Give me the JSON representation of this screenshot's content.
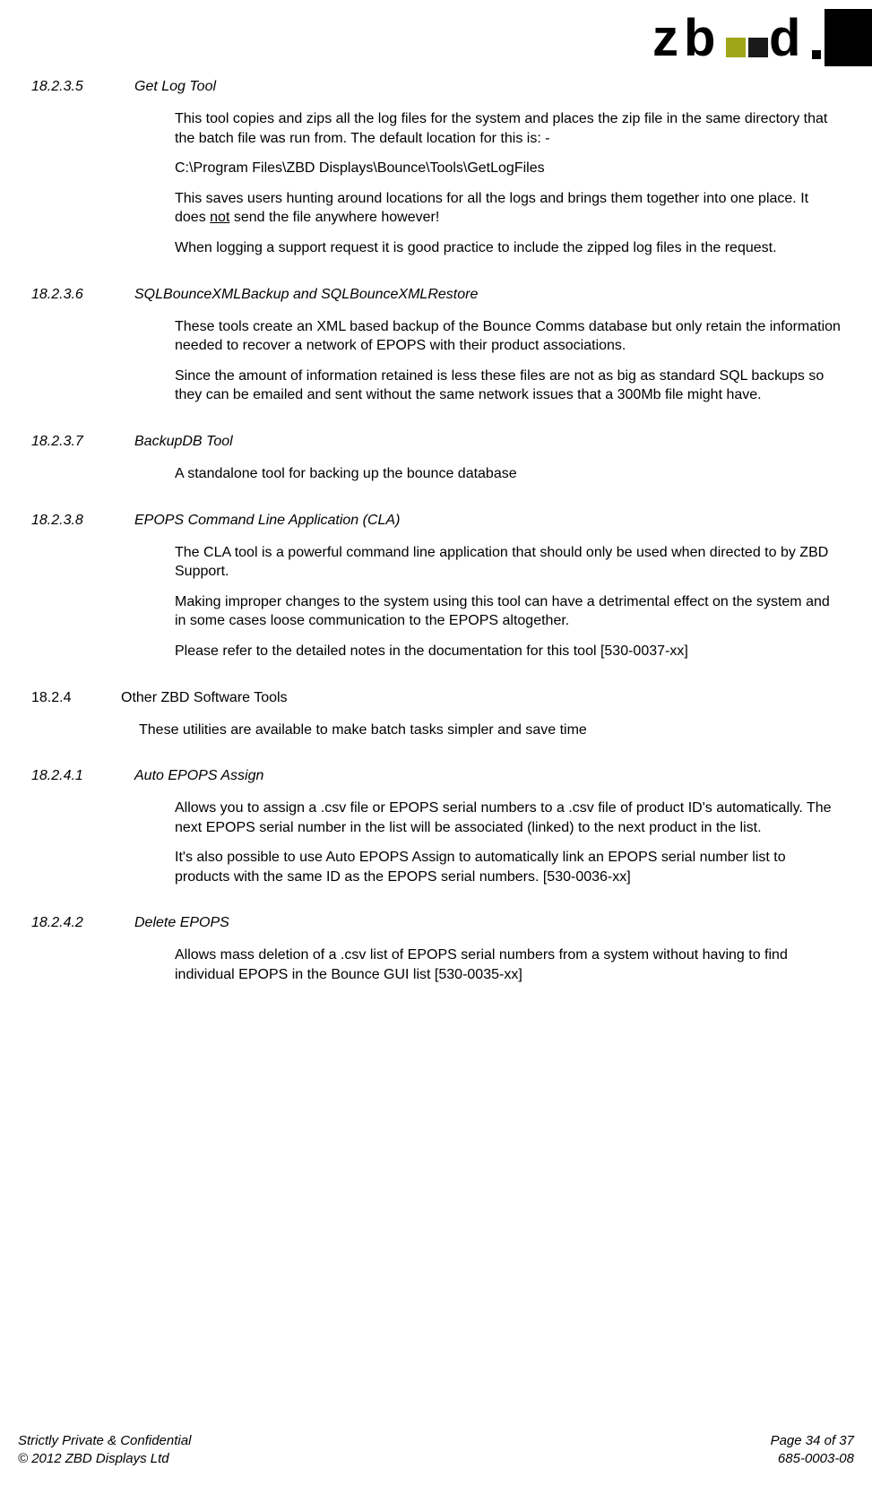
{
  "logo": {
    "alt": "zbd"
  },
  "sections": [
    {
      "num": "18.2.3.5",
      "title": "Get Log Tool",
      "paras": [
        {
          "text": "This tool copies and zips all the log files for the system and places the zip file in the same directory that the batch file was run from. The default location for this is: -"
        },
        {
          "text": "C:\\Program Files\\ZBD Displays\\Bounce\\Tools\\GetLogFiles"
        },
        {
          "pre": "This saves users hunting around locations for all the logs and brings them together into one place. It does ",
          "underline": "not",
          "post": " send the file anywhere however!"
        },
        {
          "text": "When logging a support request it is good practice to include the zipped log files in the request."
        }
      ]
    },
    {
      "num": "18.2.3.6",
      "title": "SQLBounceXMLBackup and SQLBounceXMLRestore",
      "paras": [
        {
          "text": "These tools create an XML based backup of the Bounce Comms database but only retain the information needed to recover a network of EPOPS with their product associations."
        },
        {
          "text": "Since the amount of information retained is less these files are not as big as standard SQL backups so they can be emailed and sent without the same network issues that a 300Mb file might have."
        }
      ]
    },
    {
      "num": "18.2.3.7",
      "title": "BackupDB Tool",
      "paras": [
        {
          "text": "A standalone tool for backing up the bounce database"
        }
      ]
    },
    {
      "num": "18.2.3.8",
      "title": "EPOPS Command Line Application (CLA)",
      "paras": [
        {
          "text": "The CLA tool is a powerful command line application that should only be used when directed to by ZBD Support."
        },
        {
          "text": "Making improper changes to the system using this tool can have a detrimental effect on the system and in some cases loose communication to the EPOPS altogether."
        },
        {
          "text": "Please refer to the detailed notes in the documentation for this tool [530-0037-xx]"
        }
      ]
    }
  ],
  "section_lvl2": {
    "num": "18.2.4",
    "title": "Other ZBD Software Tools",
    "intro": "These utilities are available to make batch tasks simpler and save time"
  },
  "sections2": [
    {
      "num": "18.2.4.1",
      "title": "Auto EPOPS Assign",
      "paras": [
        {
          "text": "Allows you to assign a .csv file or EPOPS serial numbers to a .csv file of product ID's automatically. The next EPOPS serial number in the list will be associated (linked) to the next product in the list."
        },
        {
          "text": "It's also possible to use Auto EPOPS Assign to automatically link an EPOPS serial number list to products with the same ID as the EPOPS serial numbers. [530-0036-xx]"
        }
      ]
    },
    {
      "num": "18.2.4.2",
      "title": "Delete EPOPS",
      "paras": [
        {
          "text": "Allows mass deletion of a .csv list of EPOPS serial numbers from a system without having to find individual EPOPS in the Bounce GUI list [530-0035-xx]"
        }
      ]
    }
  ],
  "footer": {
    "confidential": "Strictly Private & Confidential",
    "copyright": "© 2012 ZBD Displays Ltd",
    "page": "Page 34 of 37",
    "docnum": "685-0003-08"
  }
}
